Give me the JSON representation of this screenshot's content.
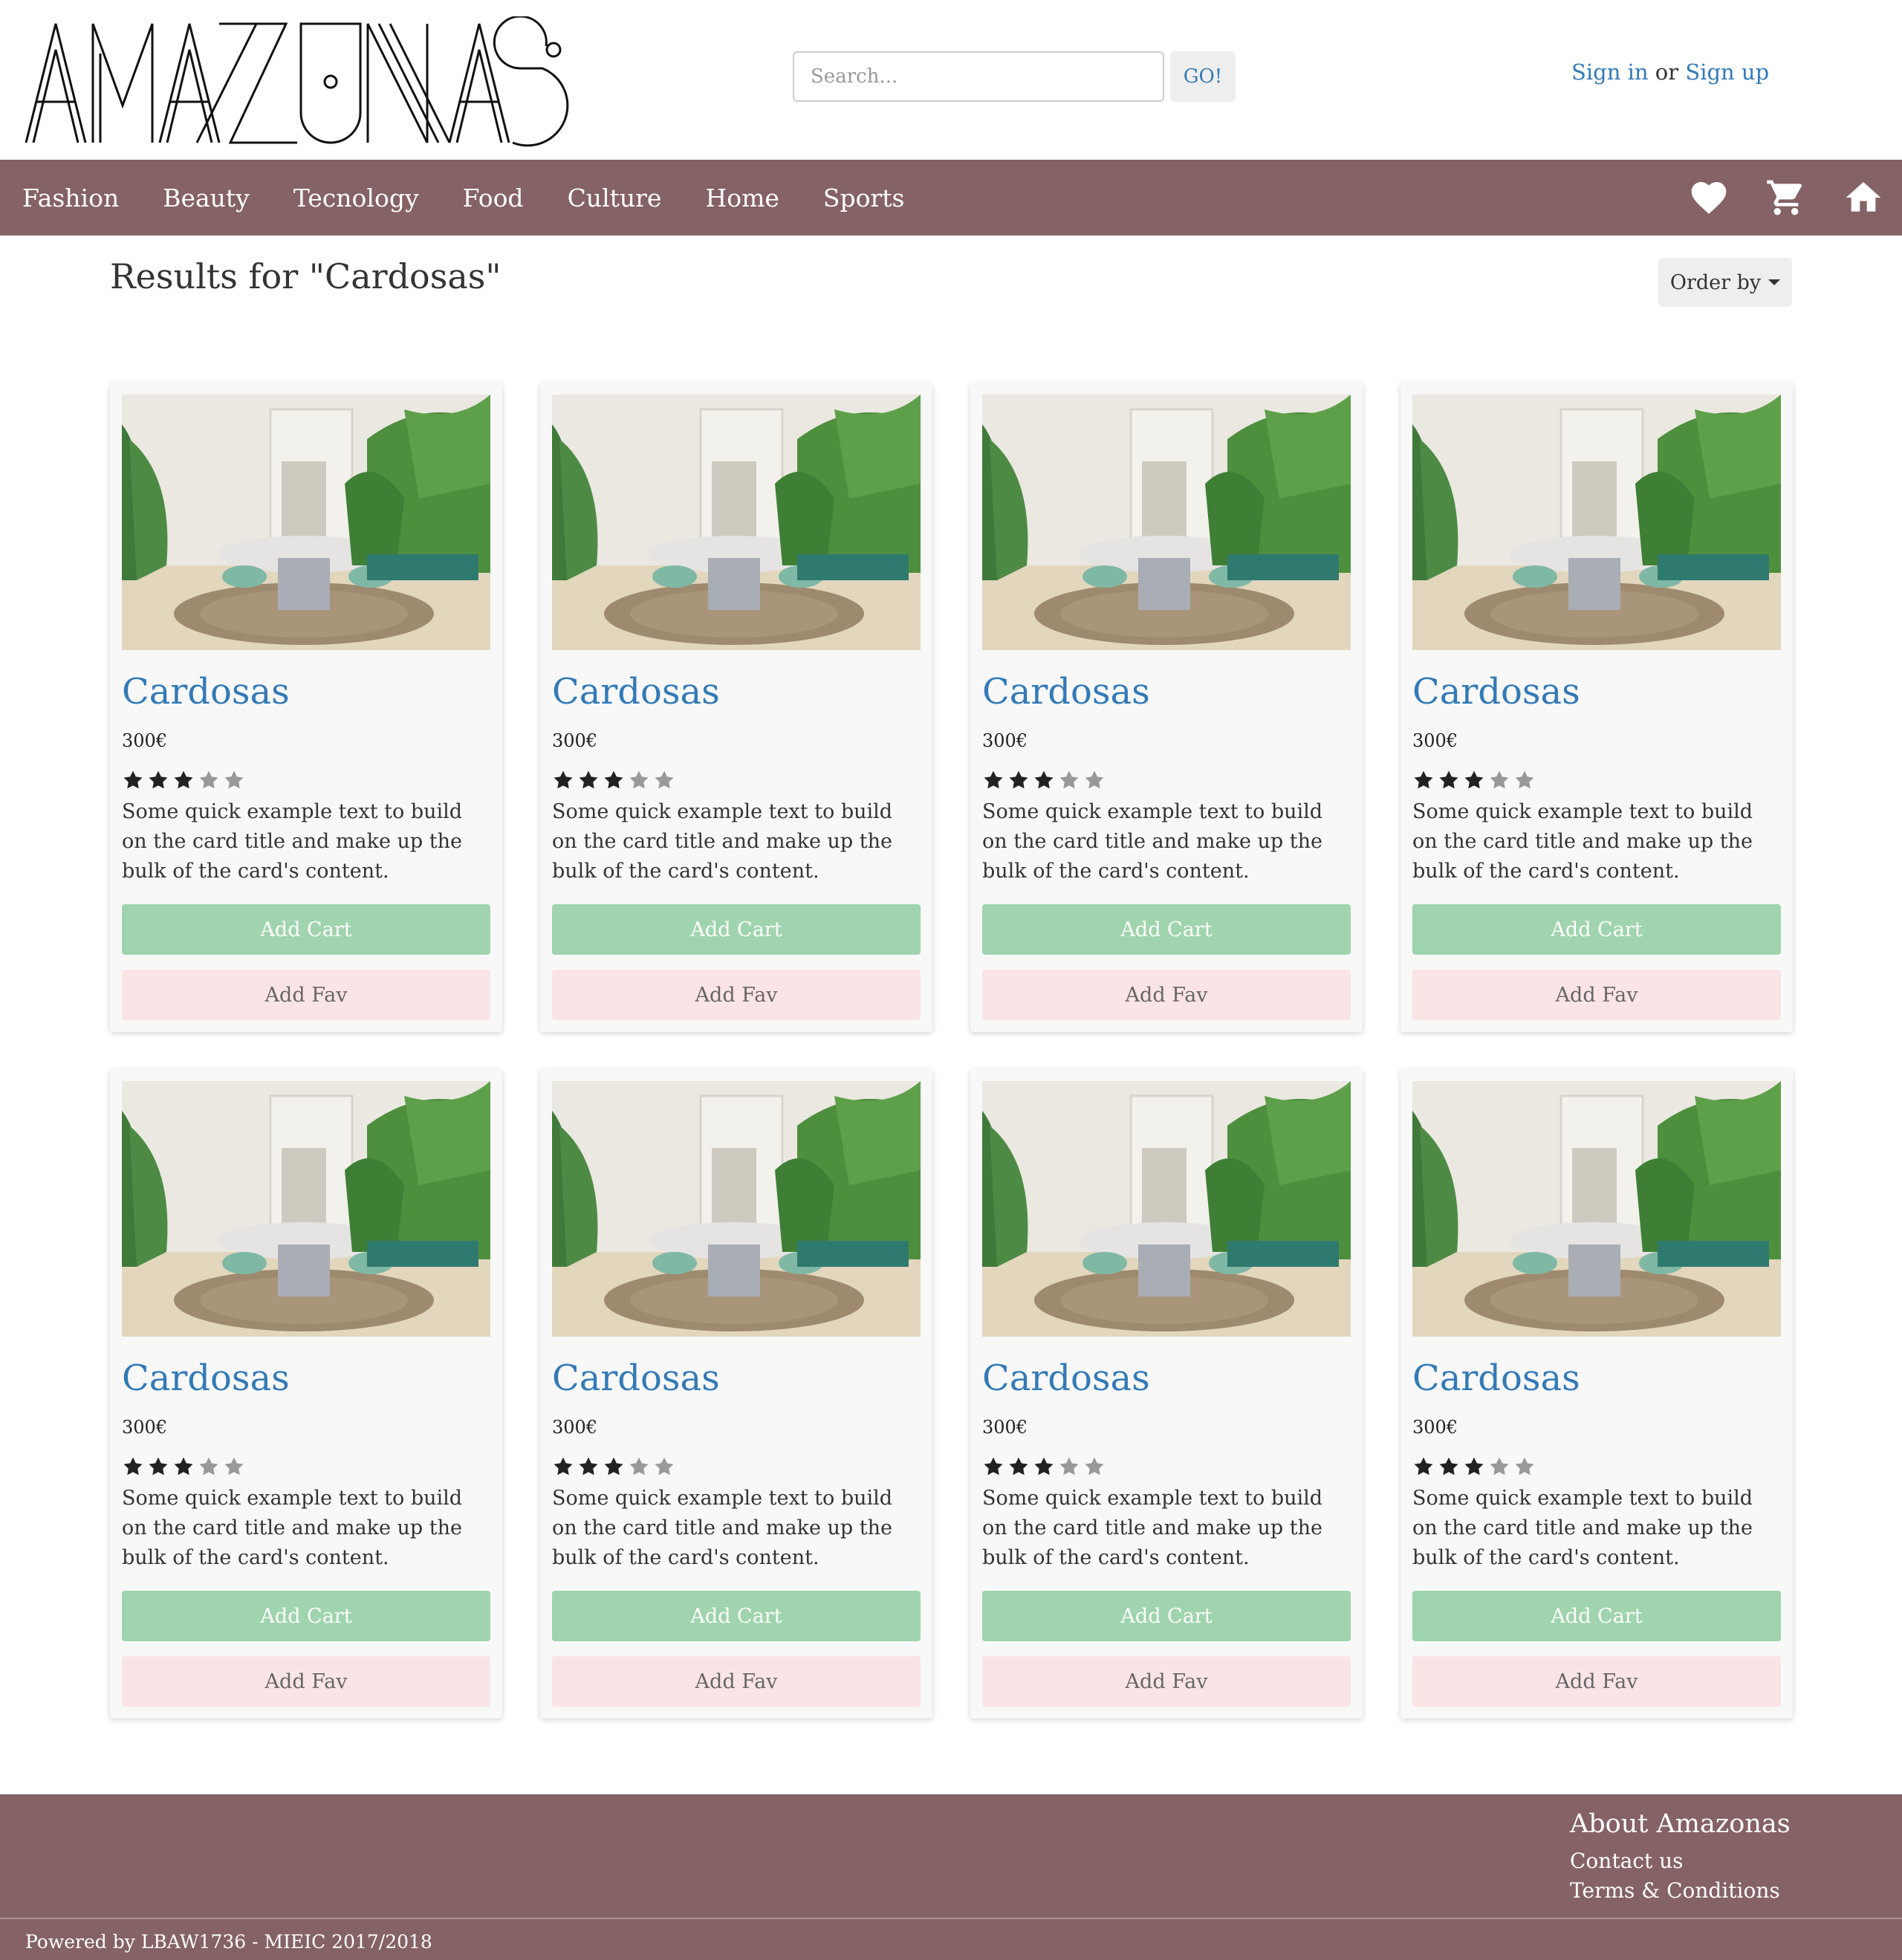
{
  "header": {
    "logo_text": "AMAZONAS",
    "search": {
      "placeholder": "Search...",
      "value": "",
      "button_label": "GO!"
    },
    "auth": {
      "sign_in": "Sign in",
      "or": "or",
      "sign_up": "Sign up"
    }
  },
  "nav": {
    "items": [
      {
        "label": "Fashion"
      },
      {
        "label": "Beauty"
      },
      {
        "label": "Tecnology"
      },
      {
        "label": "Food"
      },
      {
        "label": "Culture"
      },
      {
        "label": "Home"
      },
      {
        "label": "Sports"
      }
    ],
    "icons": [
      "heart-icon",
      "cart-icon",
      "home-icon"
    ]
  },
  "results": {
    "title": "Results for \"Cardosas\"",
    "order_label": "Order by"
  },
  "products": [
    {
      "title": "Cardosas",
      "price": "300€",
      "rating": 3,
      "max_rating": 5,
      "description": "Some quick example text to build on the card title and make up the bulk of the card's content.",
      "add_cart": "Add Cart",
      "add_fav": "Add Fav"
    },
    {
      "title": "Cardosas",
      "price": "300€",
      "rating": 3,
      "max_rating": 5,
      "description": "Some quick example text to build on the card title and make up the bulk of the card's content.",
      "add_cart": "Add Cart",
      "add_fav": "Add Fav"
    },
    {
      "title": "Cardosas",
      "price": "300€",
      "rating": 3,
      "max_rating": 5,
      "description": "Some quick example text to build on the card title and make up the bulk of the card's content.",
      "add_cart": "Add Cart",
      "add_fav": "Add Fav"
    },
    {
      "title": "Cardosas",
      "price": "300€",
      "rating": 3,
      "max_rating": 5,
      "description": "Some quick example text to build on the card title and make up the bulk of the card's content.",
      "add_cart": "Add Cart",
      "add_fav": "Add Fav"
    },
    {
      "title": "Cardosas",
      "price": "300€",
      "rating": 3,
      "max_rating": 5,
      "description": "Some quick example text to build on the card title and make up the bulk of the card's content.",
      "add_cart": "Add Cart",
      "add_fav": "Add Fav"
    },
    {
      "title": "Cardosas",
      "price": "300€",
      "rating": 3,
      "max_rating": 5,
      "description": "Some quick example text to build on the card title and make up the bulk of the card's content.",
      "add_cart": "Add Cart",
      "add_fav": "Add Fav"
    },
    {
      "title": "Cardosas",
      "price": "300€",
      "rating": 3,
      "max_rating": 5,
      "description": "Some quick example text to build on the card title and make up the bulk of the card's content.",
      "add_cart": "Add Cart",
      "add_fav": "Add Fav"
    },
    {
      "title": "Cardosas",
      "price": "300€",
      "rating": 3,
      "max_rating": 5,
      "description": "Some quick example text to build on the card title and make up the bulk of the card's content.",
      "add_cart": "Add Cart",
      "add_fav": "Add Fav"
    }
  ],
  "footer": {
    "heading": "About Amazonas",
    "links": [
      {
        "label": "Contact us"
      },
      {
        "label": "Terms & Conditions"
      }
    ],
    "credit": "Powered by LBAW1736 - MIEIC 2017/2018"
  },
  "colors": {
    "brand": "#856265",
    "link": "#337ab7",
    "add_cart": "#a0d4ae",
    "add_fav": "#fbe4e6"
  }
}
